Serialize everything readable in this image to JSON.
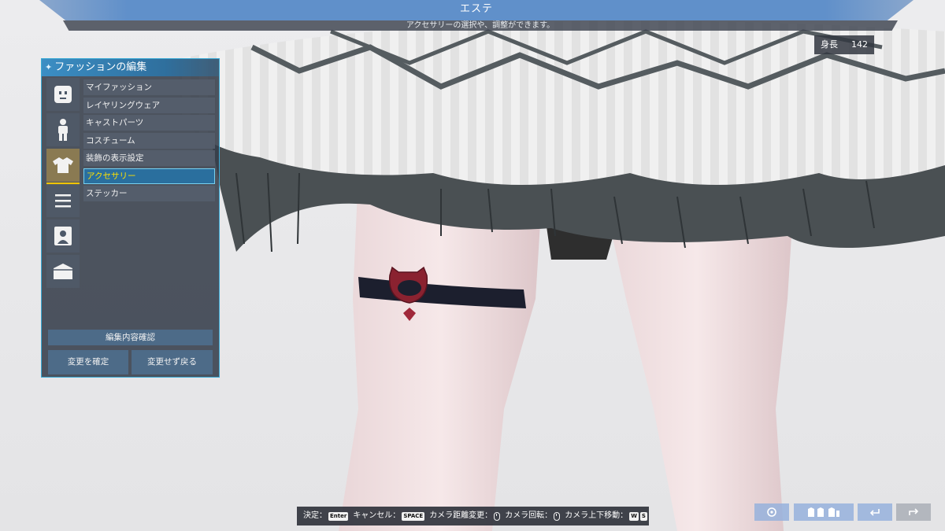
{
  "header": {
    "title": "エステ",
    "subtitle": "アクセサリーの選択や、調整ができます。"
  },
  "stats": {
    "height_label": "身長",
    "height_value": "142"
  },
  "panel": {
    "title": "ファッションの編集",
    "categories": [
      {
        "icon": "face-icon",
        "active": false
      },
      {
        "icon": "body-icon",
        "active": false
      },
      {
        "icon": "shirt-icon",
        "active": true
      },
      {
        "icon": "list-icon",
        "active": false
      },
      {
        "icon": "portrait-icon",
        "active": false
      },
      {
        "icon": "folder-icon",
        "active": false
      }
    ],
    "menu": [
      {
        "label": "マイファッション",
        "selected": false
      },
      {
        "label": "レイヤリングウェア",
        "selected": false
      },
      {
        "label": "キャストパーツ",
        "selected": false
      },
      {
        "label": "コスチューム",
        "selected": false
      },
      {
        "label": "装飾の表示設定",
        "selected": false
      },
      {
        "label": "アクセサリー",
        "selected": true
      },
      {
        "label": "ステッカー",
        "selected": false
      }
    ],
    "confirm_edit_label": "編集内容確認",
    "apply_label": "変更を確定",
    "discard_label": "変更せず戻る"
  },
  "controls": {
    "decide_label": "決定：",
    "decide_key": "Enter",
    "cancel_label": "キャンセル：",
    "cancel_key": "SPACE",
    "zoom_label": "カメラ距離変更：",
    "rotate_label": "カメラ回転：",
    "vertical_label": "カメラ上下移動：",
    "vertical_key_w": "W",
    "vertical_key_s": "S"
  },
  "colors": {
    "accent": "#3aa9d4",
    "selected_text": "#ffe000",
    "active_underline": "#f0c400"
  }
}
